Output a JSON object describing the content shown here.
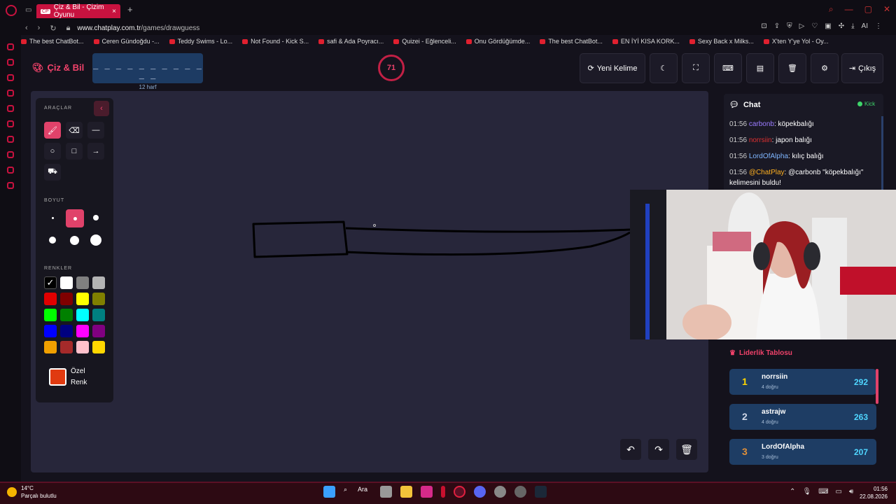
{
  "browser": {
    "tab_title": "Çiz & Bil - Çizim Oyunu",
    "tab_favicon": "CP",
    "url_host": "www.chatplay.com.tr",
    "url_path": "/games/drawguess",
    "bookmarks": [
      "The best ChatBot...",
      "Ceren Gündoğdu -...",
      "Teddy Swims - Lo...",
      "Not Found - Kick S...",
      "safi & Ada Poyracı...",
      "Quizei - Eğlenceli...",
      "Onu Gördüğümde...",
      "The best ChatBot...",
      "EN İYİ KISA KORK...",
      "Sexy Back x Milks...",
      "X'ten Y'ye Yol - Oy..."
    ],
    "ai_label": "AI"
  },
  "header": {
    "logo": "Çiz & Bil",
    "word_dashes": "_ _ _ _ _ _ _ _ _ _ _ _",
    "word_hint": "12 harf",
    "timer": "71",
    "new_word": "Yeni Kelime",
    "exit": "Çıkış"
  },
  "tools": {
    "tools_label": "ARAÇLAR",
    "size_label": "BOYUT",
    "colors_label": "RENKLER",
    "custom_color_line1": "Özel",
    "custom_color_line2": "Renk",
    "custom_color": "#e03a10",
    "palette": [
      "#000000",
      "#ffffff",
      "#808080",
      "#b4b4b4",
      "#e00000",
      "#800000",
      "#ffff00",
      "#808000",
      "#00ff00",
      "#008000",
      "#00ffff",
      "#008080",
      "#0000ff",
      "#000080",
      "#ff00ff",
      "#800080",
      "#f0a000",
      "#a52a2a",
      "#ffc0cb",
      "#ffd700"
    ]
  },
  "chat": {
    "title": "Chat",
    "platform": "Kick",
    "messages": [
      {
        "time": "01:56",
        "user": "carbonb",
        "user_color": "#9b7cff",
        "text": ": köpekbalığı"
      },
      {
        "time": "01:56",
        "user": "norrsiin",
        "user_color": "#e03030",
        "text": ": japon balığı"
      },
      {
        "time": "01:56",
        "user": "LordOfAlpha",
        "user_color": "#7fb6ff",
        "text": ": kılıç balığı"
      },
      {
        "time": "01:56",
        "user": "@ChatPlay",
        "user_color": "#ffb020",
        "text": ": @carbonb \"köpekbalığı\" kelimesini buldu!"
      }
    ]
  },
  "leaderboard": {
    "title": "Liderlik Tablosu",
    "rows": [
      {
        "rank": "1",
        "name": "norrsiin",
        "sub": "4 doğru",
        "score": "292",
        "rank_color": "#ffd700"
      },
      {
        "rank": "2",
        "name": "astrajw",
        "sub": "4 doğru",
        "score": "263",
        "rank_color": "#d0d8e8"
      },
      {
        "rank": "3",
        "name": "LordOfAlpha",
        "sub": "3 doğru",
        "score": "207",
        "rank_color": "#e0903a"
      }
    ]
  },
  "taskbar": {
    "temp": "14°C",
    "weather": "Parçalı bulutlu",
    "search": "Ara",
    "time": "01:56",
    "date": "22.08.2026"
  }
}
